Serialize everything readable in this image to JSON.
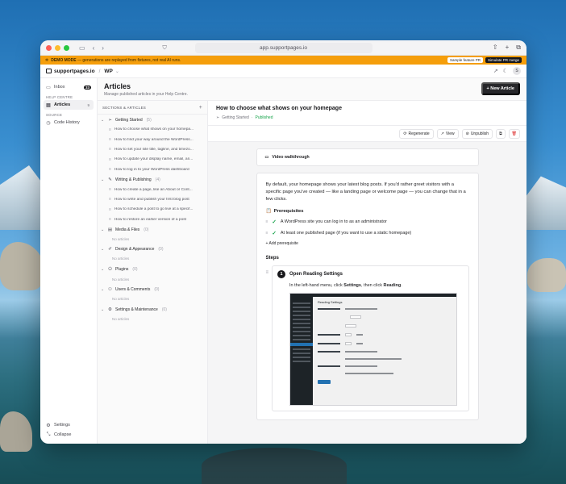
{
  "browser": {
    "url": "app.supportpages.io"
  },
  "demo": {
    "label": "DEMO MODE",
    "message": " — generations are replayed from fixtures, not real AI runs.",
    "sample_btn": "Sample feature PR",
    "simulate_btn": "Simulate PR merge"
  },
  "app": {
    "brand": "supportpages.io",
    "workspace": "WP",
    "avatar": "S"
  },
  "sidebar": {
    "inbox": {
      "label": "Inbox",
      "count": "33"
    },
    "help_centre_head": "HELP CENTRE",
    "articles": {
      "label": "Articles",
      "count": "9"
    },
    "source_head": "SOURCE",
    "code_history": "Code History",
    "settings": "Settings",
    "collapse": "Collapse"
  },
  "page": {
    "title": "Articles",
    "subtitle": "Manage published articles in your Help Centre.",
    "new_button": "+ New Article"
  },
  "tree": {
    "header": "SECTIONS & ARTICLES",
    "no_articles": "No articles",
    "sections": [
      {
        "name": "Getting Started",
        "count": "(5)",
        "icon": "send-icon",
        "articles": [
          "How to choose what shows on your homepa...",
          "How to find your way around the WordPress...",
          "How to set your site title, tagline, and timezo...",
          "How to update your display name, email, an...",
          "How to log in to your WordPress dashboard"
        ]
      },
      {
        "name": "Writing & Publishing",
        "count": "(4)",
        "icon": "pen-icon",
        "articles": [
          "How to create a page, like an About or Cont...",
          "How to write and publish your first blog post",
          "How to schedule a post to go live at a specif...",
          "How to restore an earlier version of a post"
        ]
      },
      {
        "name": "Media & Files",
        "count": "(0)",
        "icon": "file-icon",
        "articles": []
      },
      {
        "name": "Design & Appearance",
        "count": "(0)",
        "icon": "brush-icon",
        "articles": []
      },
      {
        "name": "Plugins",
        "count": "(0)",
        "icon": "plug-icon",
        "articles": []
      },
      {
        "name": "Users & Comments",
        "count": "(0)",
        "icon": "users-icon",
        "articles": []
      },
      {
        "name": "Settings & Maintenance",
        "count": "(0)",
        "icon": "gear-icon",
        "articles": []
      }
    ]
  },
  "detail": {
    "title": "How to choose what shows on your homepage",
    "section": "Getting Started",
    "separator": "·",
    "status": "Published",
    "toolbar": {
      "regenerate": "Regenerate",
      "view": "View",
      "unpublish": "Unpublish"
    },
    "video_label": "Video walkthrough",
    "intro": "By default, your homepage shows your latest blog posts. If you'd rather greet visitors with a specific page you've created — like a landing page or welcome page — you can change that in a few clicks.",
    "prereq_head": "Prerequisites",
    "prerequisites": [
      "A WordPress site you can log in to as an administrator",
      "At least one published page (if you want to use a static homepage)"
    ],
    "add_prereq": "+ Add prerequisite",
    "steps_head": "Steps",
    "step": {
      "number": "1",
      "title": "Open Reading Settings",
      "desc_pre": "In the left-hand menu, click ",
      "desc_b1": "Settings",
      "desc_mid": ", then click ",
      "desc_b2": "Reading",
      "desc_post": ".",
      "screenshot_title": "Reading Settings"
    }
  },
  "colors": {
    "accent_dark": "#18181b",
    "demo_bar": "#f59e0b",
    "published": "#16a34a",
    "danger": "#dc2626"
  }
}
